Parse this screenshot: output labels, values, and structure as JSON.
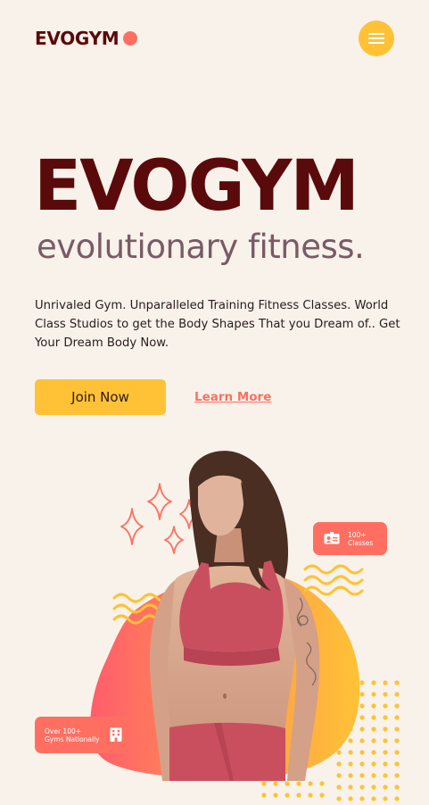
{
  "header": {
    "logo_text": "EVOGYM",
    "menu_icon": "hamburger-menu-icon"
  },
  "hero": {
    "title": "EVOGYM",
    "subtitle": "evolutionary fitness.",
    "description": "Unrivaled Gym. Unparalleled Training Fitness Classes. World Class Studios to get the Body Shapes That you Dream of.. Get Your Dream Body Now.",
    "join_label": "Join Now",
    "learn_label": "Learn More"
  },
  "badges": {
    "classes_line1": "100+",
    "classes_line2": "Classes",
    "classes_icon": "id-card-icon",
    "gyms_line1": "Over 100+",
    "gyms_line2": "Gyms Nationally",
    "gyms_icon": "building-icon"
  },
  "colors": {
    "background": "#f8f2ea",
    "brand_dark": "#5a0a0a",
    "accent_coral": "#ff6f61",
    "accent_yellow": "#ffc236"
  }
}
